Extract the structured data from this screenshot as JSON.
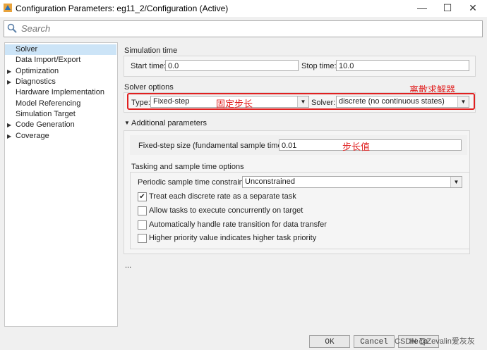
{
  "window": {
    "title": "Configuration Parameters: eg11_2/Configuration (Active)",
    "minimize": "—",
    "maximize": "☐",
    "close": "✕"
  },
  "search": {
    "placeholder": "Search"
  },
  "tree": [
    {
      "label": "Solver",
      "selected": true,
      "expandable": false
    },
    {
      "label": "Data Import/Export",
      "expandable": false
    },
    {
      "label": "Optimization",
      "expandable": true
    },
    {
      "label": "Diagnostics",
      "expandable": true
    },
    {
      "label": "Hardware Implementation",
      "expandable": false
    },
    {
      "label": "Model Referencing",
      "expandable": false
    },
    {
      "label": "Simulation Target",
      "expandable": false
    },
    {
      "label": "Code Generation",
      "expandable": true
    },
    {
      "label": "Coverage",
      "expandable": true
    }
  ],
  "simulation_time": {
    "title": "Simulation time",
    "start_label": "Start time:",
    "start_value": "0.0",
    "stop_label": "Stop time:",
    "stop_value": "10.0"
  },
  "solver_options": {
    "title": "Solver options",
    "type_label": "Type:",
    "type_value": "Fixed-step",
    "solver_label": "Solver:",
    "solver_value": "discrete (no continuous states)"
  },
  "additional": {
    "title": "Additional parameters",
    "step_label": "Fixed-step size (fundamental sample time):",
    "step_value": "0.01",
    "tasking_title": "Tasking and sample time options",
    "periodic_label": "Periodic sample time constraint:",
    "periodic_value": "Unconstrained",
    "checkboxes": [
      {
        "label": "Treat each discrete rate as a separate task",
        "checked": true
      },
      {
        "label": "Allow tasks to execute concurrently on target",
        "checked": false
      },
      {
        "label": "Automatically handle rate transition for data transfer",
        "checked": false
      },
      {
        "label": "Higher priority value indicates higher task priority",
        "checked": false
      }
    ]
  },
  "ellipsis": "...",
  "annotations": {
    "fixed_step": "固定步长",
    "discrete_solver": "离散求解器",
    "step_value": "步长值"
  },
  "buttons": {
    "ok": "OK",
    "cancel": "Cancel",
    "help": "Help"
  },
  "watermark": "CSDN @Zevalin爱灰灰",
  "colors": {
    "annotation": "#e02020",
    "selected": "#cce4f7"
  }
}
